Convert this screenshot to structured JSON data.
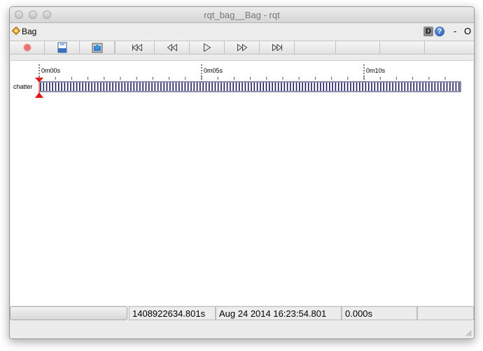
{
  "window": {
    "title": "rqt_bag__Bag - rqt"
  },
  "plugin": {
    "name": "Bag",
    "debug_label": "D",
    "help_label": "?",
    "minimize_label": "-",
    "close_label": "O"
  },
  "toolbar": {
    "buttons": [
      {
        "name": "record-button",
        "icon": "record-icon"
      },
      {
        "name": "open-bag-button",
        "icon": "open-icon"
      },
      {
        "name": "save-bag-button",
        "icon": "save-icon"
      },
      {
        "name": "go-to-beginning-button",
        "icon": "skip-start-icon"
      },
      {
        "name": "rewind-button",
        "icon": "rewind-icon"
      },
      {
        "name": "play-button",
        "icon": "play-icon"
      },
      {
        "name": "fast-forward-button",
        "icon": "fast-forward-icon"
      },
      {
        "name": "go-to-end-button",
        "icon": "skip-end-icon"
      }
    ]
  },
  "timeline": {
    "time_labels": [
      "0m00s",
      "0m05s",
      "0m10s"
    ],
    "topics": [
      {
        "name": "chatter"
      }
    ],
    "playhead_color": "#e01818",
    "message_color": "#1c1c5e"
  },
  "status": {
    "timestamp": "1408922634.801s",
    "date": "Aug 24 2014 16:23:54.801",
    "elapsed": "0.000s"
  }
}
